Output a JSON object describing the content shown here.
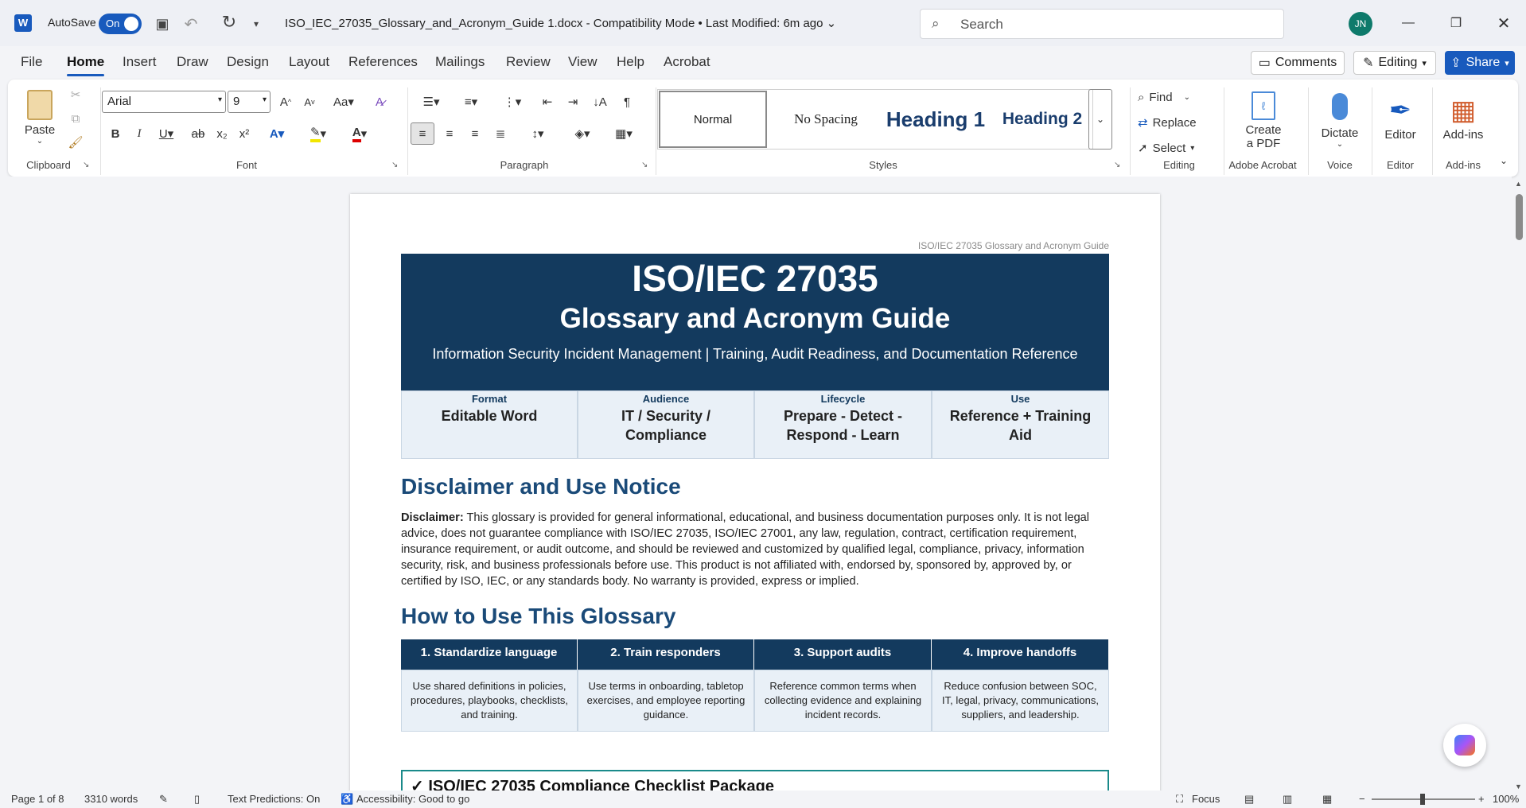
{
  "titlebar": {
    "autosave_label": "AutoSave",
    "autosave_state": "On",
    "filename": "ISO_IEC_27035_Glossary_and_Acronym_Guide 1.docx",
    "mode": "Compatibility Mode",
    "modified": "Last Modified: 6m ago",
    "search_placeholder": "Search",
    "user_initials": "JN"
  },
  "tabs": [
    "File",
    "Home",
    "Insert",
    "Draw",
    "Design",
    "Layout",
    "References",
    "Mailings",
    "Review",
    "View",
    "Help",
    "Acrobat"
  ],
  "top_right": {
    "comments": "Comments",
    "editing": "Editing",
    "share": "Share"
  },
  "ribbon": {
    "clipboard": {
      "paste": "Paste",
      "label": "Clipboard"
    },
    "font": {
      "name": "Arial",
      "size": "9",
      "label": "Font"
    },
    "paragraph": {
      "label": "Paragraph"
    },
    "styles": {
      "items": [
        "Normal",
        "No Spacing",
        "Heading 1",
        "Heading 2"
      ],
      "label": "Styles"
    },
    "editing": {
      "find": "Find",
      "replace": "Replace",
      "select": "Select",
      "label": "Editing"
    },
    "acrobat": {
      "create": "Create",
      "create2": "a PDF",
      "label": "Adobe Acrobat"
    },
    "voice": {
      "dictate": "Dictate",
      "label": "Voice"
    },
    "editor": {
      "editor": "Editor",
      "label": "Editor"
    },
    "addins": {
      "addins": "Add-ins",
      "label": "Add-ins"
    }
  },
  "document": {
    "header_text": "ISO/IEC 27035 Glossary and Acronym Guide",
    "title1": "ISO/IEC 27035",
    "title2": "Glossary and Acronym Guide",
    "subtitle": "Information Security Incident Management | Training, Audit Readiness, and Documentation Reference",
    "meta": [
      {
        "key": "Format",
        "value": "Editable Word"
      },
      {
        "key": "Audience",
        "value": "IT / Security / Compliance"
      },
      {
        "key": "Lifecycle",
        "value": "Prepare - Detect - Respond - Learn"
      },
      {
        "key": "Use",
        "value": "Reference + Training Aid"
      }
    ],
    "disclaimer_heading": "Disclaimer and Use Notice",
    "disclaimer_bold": "Disclaimer:",
    "disclaimer_text": "This glossary is provided for general informational, educational, and business documentation purposes only. It is not legal advice, does not guarantee compliance with ISO/IEC 27035, ISO/IEC 27001, any law, regulation, contract, certification requirement, insurance requirement, or audit outcome, and should be reviewed and customized by qualified legal, compliance, privacy, information security, risk, and business professionals before use. This product is not affiliated with, endorsed by, sponsored by, approved by, or certified by ISO, IEC, or any standards body. No warranty is provided, express or implied.",
    "howto_heading": "How to Use This Glossary",
    "howto": [
      {
        "head": "1. Standardize language",
        "body": "Use shared definitions in policies, procedures, playbooks, checklists, and training."
      },
      {
        "head": "2. Train responders",
        "body": "Use terms in onboarding, tabletop exercises, and employee reporting guidance."
      },
      {
        "head": "3. Support audits",
        "body": "Reference common terms when collecting evidence and explaining incident records."
      },
      {
        "head": "4. Improve handoffs",
        "body": "Reduce confusion between SOC, IT, legal, privacy, communications, suppliers, and leadership."
      }
    ],
    "checklist": "✓ ISO/IEC 27035 Compliance Checklist Package"
  },
  "status": {
    "page": "Page 1 of 8",
    "words": "3310 words",
    "predictions": "Text Predictions: On",
    "accessibility": "Accessibility: Good to go",
    "focus": "Focus",
    "zoom": "100%"
  },
  "colors": {
    "accent": "#185abd",
    "banner": "#133a5e",
    "heading": "#1a4a78"
  }
}
